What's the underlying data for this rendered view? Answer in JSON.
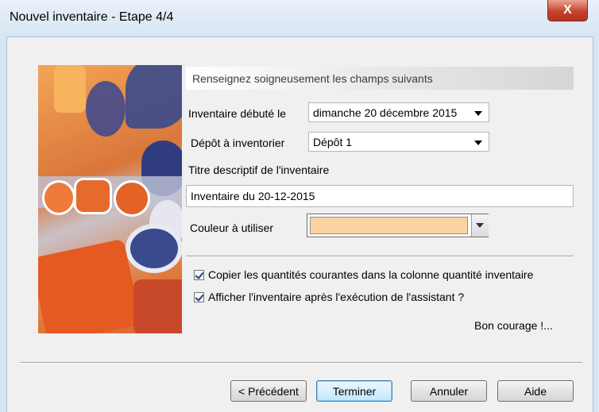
{
  "window": {
    "title": "Nouvel inventaire - Etape 4/4",
    "close_glyph": "X"
  },
  "heading": "Renseignez soigneusement les champs suivants",
  "fields": {
    "start_label": "Inventaire débuté le",
    "start_value": "dimanche 20 décembre 2015",
    "depot_label": "Dépôt à inventorier",
    "depot_value": "Dépôt 1",
    "title_label": "Titre descriptif de l'inventaire",
    "title_value": "Inventaire du 20-12-2015",
    "color_label": "Couleur à utiliser",
    "color_value": "#fcd3a2"
  },
  "options": [
    {
      "label": "Copier les quantités courantes dans la colonne quantité inventaire",
      "checked": true
    },
    {
      "label": "Afficher l'inventaire après l'exécution de l'assistant ?",
      "checked": true
    }
  ],
  "footer_text": "Bon courage !...",
  "buttons": {
    "previous": "< Précédent",
    "finish": "Terminer",
    "cancel": "Annuler",
    "help": "Aide"
  }
}
